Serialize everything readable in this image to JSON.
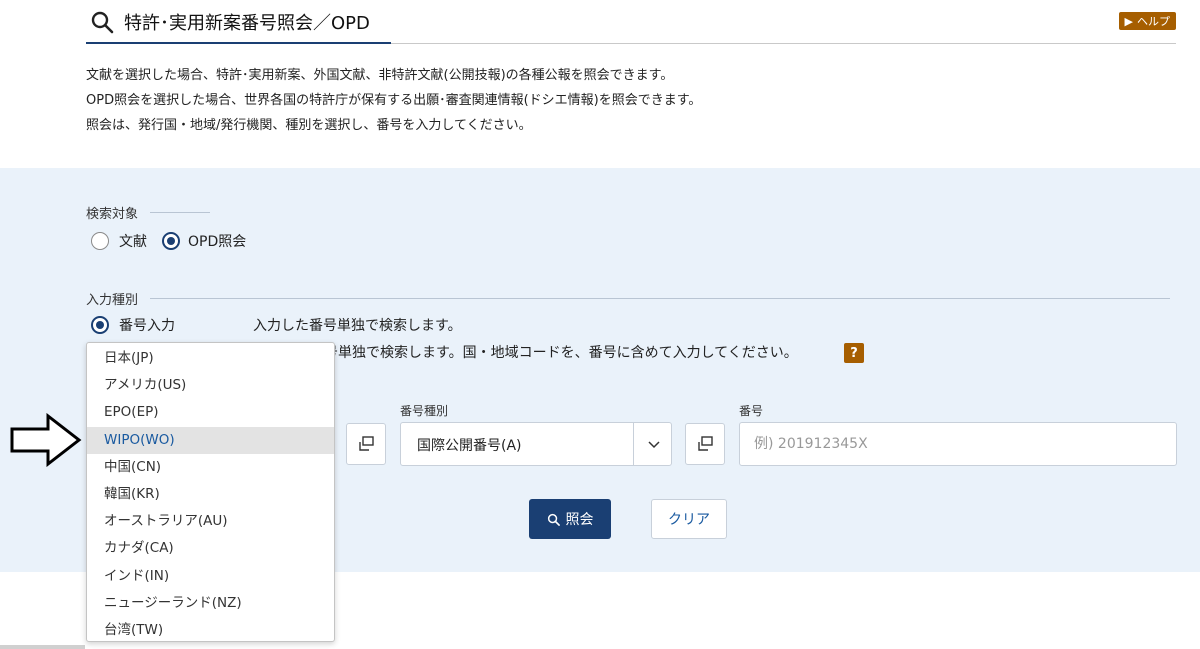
{
  "header": {
    "title": "特許･実用新案番号照会／OPD",
    "help_label": "ヘルプ"
  },
  "description": [
    "文献を選択した場合、特許･実用新案、外国文献、非特許文献(公開技報)の各種公報を照会できます。",
    "OPD照会を選択した場合、世界各国の特許庁が保有する出願･審査関連情報(ドシエ情報)を照会できます。",
    "照会は、発行国・地域/発行機関、種別を選択し、番号を入力してください。"
  ],
  "search_target": {
    "label": "検索対象",
    "options": [
      {
        "label": "文献",
        "selected": false
      },
      {
        "label": "OPD照会",
        "selected": true
      }
    ]
  },
  "input_type": {
    "label": "入力種別",
    "options": [
      {
        "label": "番号入力",
        "selected": true,
        "description": "入力した番号単独で検索します。"
      },
      {
        "label": "",
        "selected": false,
        "description": "番号単独で検索します。国・地域コードを、番号に含めて入力してください。"
      }
    ]
  },
  "fields": {
    "kind_label": "番号種別",
    "kind_value": "国際公開番号(A)",
    "number_label": "番号",
    "number_placeholder": "例) 201912345X"
  },
  "buttons": {
    "search": "照会",
    "clear": "クリア"
  },
  "country_dropdown": {
    "items": [
      "日本(JP)",
      "アメリカ(US)",
      "EPO(EP)",
      "WIPO(WO)",
      "中国(CN)",
      "韓国(KR)",
      "オーストラリア(AU)",
      "カナダ(CA)",
      "インド(IN)",
      "ニュージーランド(NZ)",
      "台湾(TW)"
    ],
    "highlighted": "WIPO(WO)"
  },
  "colors": {
    "primary": "#1a3f73",
    "accent": "#a65e00",
    "panel_bg": "#eaf2fa",
    "link": "#1a5aa0"
  }
}
